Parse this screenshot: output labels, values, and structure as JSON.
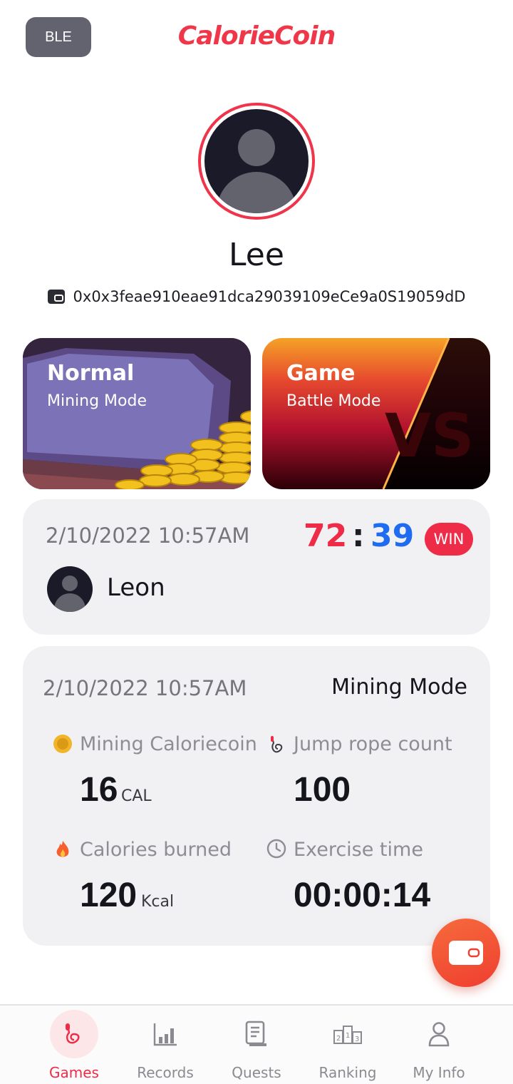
{
  "header": {
    "ble_label": "BLE",
    "app_name": "CalorieCoin"
  },
  "profile": {
    "name": "Lee",
    "wallet_address": "0x0x3feae910eae91dca29039109eCe9a0S19059dD"
  },
  "modes": [
    {
      "title": "Normal",
      "subtitle": "Mining Mode"
    },
    {
      "title": "Game",
      "subtitle": "Battle Mode",
      "art_text": "VS"
    }
  ],
  "battle": {
    "date": "2/10/2022 10:57AM",
    "score_left": "72",
    "separator": ":",
    "score_right": "39",
    "result": "WIN",
    "opponent": "Leon"
  },
  "mining": {
    "date": "2/10/2022 10:57AM",
    "mode": "Mining Mode",
    "stats": [
      {
        "icon": "coin-icon",
        "label": "Mining Caloriecoin",
        "value": "16",
        "unit": "CAL"
      },
      {
        "icon": "jump-rope-icon",
        "label": "Jump rope count",
        "value": "100",
        "unit": ""
      },
      {
        "icon": "flame-icon",
        "label": "Calories burned",
        "value": "120",
        "unit": "Kcal"
      },
      {
        "icon": "clock-icon",
        "label": "Exercise time",
        "value": "00:00:14",
        "unit": ""
      }
    ]
  },
  "nav": [
    {
      "label": "Games",
      "icon": "jump-rope-icon",
      "active": true
    },
    {
      "label": "Records",
      "icon": "bar-chart-icon",
      "active": false
    },
    {
      "label": "Quests",
      "icon": "scroll-icon",
      "active": false
    },
    {
      "label": "Ranking",
      "icon": "podium-icon",
      "active": false
    },
    {
      "label": "My Info",
      "icon": "person-icon",
      "active": false
    }
  ],
  "colors": {
    "accent": "#ef2c48",
    "blue": "#1f6cf0",
    "card_bg": "#f1f1f4"
  }
}
